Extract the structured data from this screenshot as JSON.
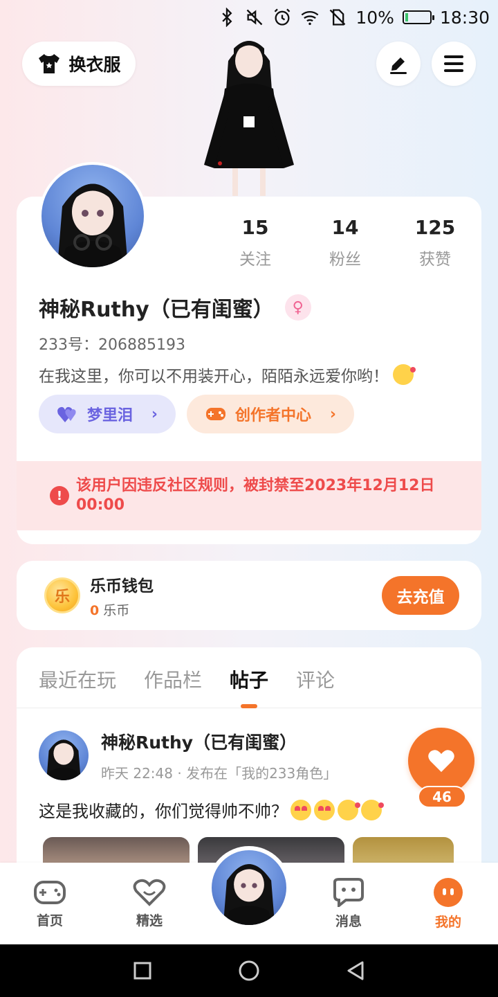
{
  "status_bar": {
    "battery": "10%",
    "time": "18:30"
  },
  "header": {
    "outfit_label": "换衣服"
  },
  "profile": {
    "stats": [
      {
        "value": "15",
        "label": "关注"
      },
      {
        "value": "14",
        "label": "粉丝"
      },
      {
        "value": "125",
        "label": "获赞"
      }
    ],
    "name": "神秘Ruthy（已有闺蜜）",
    "uid": "233号：206885193",
    "bio": "在我这里，你可以不用装开心，陌陌永远爱你哟！",
    "tags": [
      {
        "label": "梦里泪",
        "color": "#6a63e0"
      },
      {
        "label": "创作者中心",
        "color": "#f4742a"
      }
    ],
    "ban_notice": "该用户因违反社区规则，被封禁至2023年12月12日 00:00"
  },
  "wallet": {
    "title": "乐币钱包",
    "balance": "0",
    "unit": "乐币",
    "coin_char": "乐",
    "recharge_label": "去充值"
  },
  "tabs": [
    {
      "label": "最近在玩",
      "active": false
    },
    {
      "label": "作品栏",
      "active": false
    },
    {
      "label": "帖子",
      "active": true
    },
    {
      "label": "评论",
      "active": false
    }
  ],
  "post": {
    "author": "神秘Ruthy（已有闺蜜）",
    "meta": "昨天 22:48 · 发布在「我的233角色」",
    "text": "这是我收藏的，你们觉得帅不帅？",
    "likes": "46"
  },
  "bottom_nav": [
    {
      "label": "首页",
      "icon": "gamepad-icon",
      "active": false
    },
    {
      "label": "精选",
      "icon": "heart-badge-icon",
      "active": false
    },
    {
      "label": "消息",
      "icon": "chat-icon",
      "active": false
    },
    {
      "label": "我的",
      "icon": "profile-face-icon",
      "active": true
    }
  ],
  "colors": {
    "accent": "#f4742a",
    "warning": "#ee4b4b",
    "purple": "#6a63e0"
  }
}
